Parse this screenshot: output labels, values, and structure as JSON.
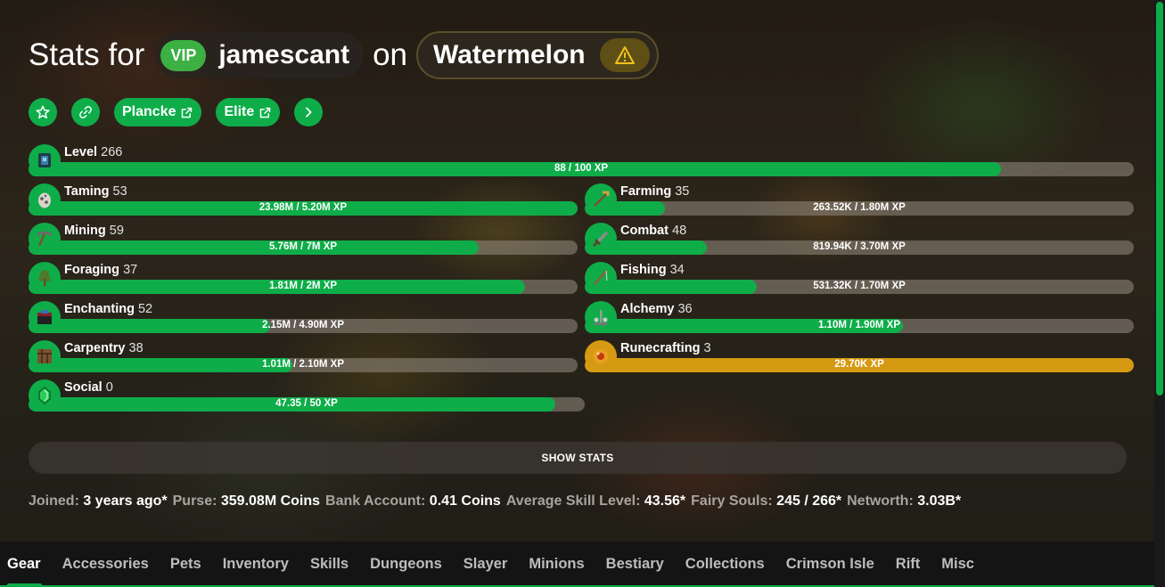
{
  "header": {
    "prefix": "Stats for",
    "vip": "VIP",
    "username": "jamescant",
    "on": "on",
    "profile": "Watermelon"
  },
  "buttons": {
    "plancke": "Plancke",
    "elite": "Elite"
  },
  "level": {
    "name": "Level",
    "level": "266",
    "xp": "88 / 100 XP",
    "progress": 0.88
  },
  "skills_left": [
    {
      "name": "Taming",
      "level": "53",
      "xp": "23.98M / 5.20M XP",
      "progress": 1.0,
      "icon": "spawn-egg-icon",
      "color": "#d8d4cc"
    },
    {
      "name": "Mining",
      "level": "59",
      "xp": "5.76M / 7M XP",
      "progress": 0.82,
      "icon": "pickaxe-icon",
      "color": "#6b6b6b"
    },
    {
      "name": "Foraging",
      "level": "37",
      "xp": "1.81M / 2M XP",
      "progress": 0.905,
      "icon": "sapling-icon",
      "color": "#4f7a2a"
    },
    {
      "name": "Enchanting",
      "level": "52",
      "xp": "2.15M / 4.90M XP",
      "progress": 0.44,
      "icon": "enchanting-table-icon",
      "color": "#8a1f2a"
    },
    {
      "name": "Carpentry",
      "level": "38",
      "xp": "1.01M / 2.10M XP",
      "progress": 0.48,
      "icon": "crafting-table-icon",
      "color": "#7a5230"
    },
    {
      "name": "Social",
      "level": "0",
      "xp": "47.35 / 50 XP",
      "progress": 0.947,
      "icon": "emerald-icon",
      "color": "#2ecc5c"
    }
  ],
  "skills_right": [
    {
      "name": "Farming",
      "level": "35",
      "xp": "263.52K / 1.80M XP",
      "progress": 0.146,
      "icon": "hoe-icon",
      "color": "#c8a24a"
    },
    {
      "name": "Combat",
      "level": "48",
      "xp": "819.94K / 3.70M XP",
      "progress": 0.222,
      "icon": "sword-icon",
      "color": "#8b8b8b"
    },
    {
      "name": "Fishing",
      "level": "34",
      "xp": "531.32K / 1.70M XP",
      "progress": 0.313,
      "icon": "fishing-rod-icon",
      "color": "#8a6238"
    },
    {
      "name": "Alchemy",
      "level": "36",
      "xp": "1.10M / 1.90M XP",
      "progress": 0.579,
      "icon": "brewing-stand-icon",
      "color": "#9a9a9a"
    },
    {
      "name": "Runecrafting",
      "level": "3",
      "xp": "29.70K XP",
      "progress": 1.0,
      "icon": "magma-cream-icon",
      "color": "#e8a020",
      "gold": true
    }
  ],
  "show_stats": "SHOW STATS",
  "info": [
    {
      "k": "Joined:",
      "v": "3 years ago*"
    },
    {
      "k": "Purse:",
      "v": "359.08M Coins"
    },
    {
      "k": "Bank Account:",
      "v": "0.41 Coins"
    },
    {
      "k": "Average Skill Level:",
      "v": "43.56*"
    },
    {
      "k": "Fairy Souls:",
      "v": "245 / 266*"
    },
    {
      "k": "Networth:",
      "v": "3.03B*"
    }
  ],
  "tabs": [
    "Gear",
    "Accessories",
    "Pets",
    "Inventory",
    "Skills",
    "Dungeons",
    "Slayer",
    "Minions",
    "Bestiary",
    "Collections",
    "Crimson Isle",
    "Rift",
    "Misc"
  ],
  "colors": {
    "accent": "#0ead49",
    "gold": "#d69a12"
  }
}
